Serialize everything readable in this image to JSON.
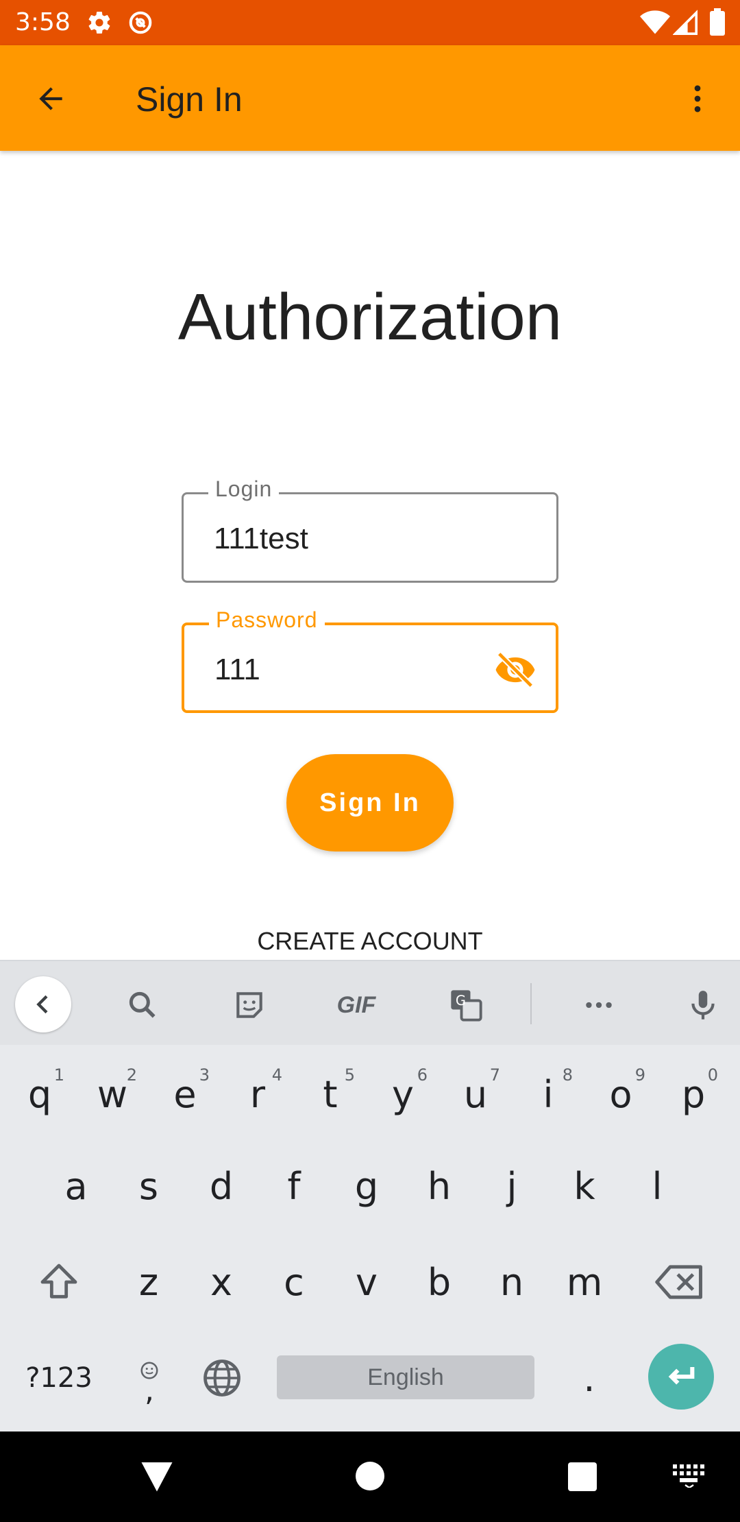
{
  "status_bar": {
    "time": "3:58",
    "icons": [
      "gear-icon",
      "sync-icon",
      "wifi-icon",
      "signal-icon",
      "battery-icon"
    ],
    "background": "#e65100"
  },
  "app_bar": {
    "title": "Sign In",
    "back_icon": "arrow-left-icon",
    "menu_icon": "more-vert-icon",
    "background": "#ff9800"
  },
  "main": {
    "heading": "Authorization",
    "login": {
      "label": "Login",
      "value": "111test"
    },
    "password": {
      "label": "Password",
      "value": "111",
      "toggle_icon": "eye-off-icon"
    },
    "sign_in_button": "Sign In",
    "create_account": "CREATE ACCOUNT",
    "accent": "#ff9800"
  },
  "keyboard": {
    "toolbar_icons": [
      "chevron-left-icon",
      "search-icon",
      "sticker-icon",
      "gif-icon",
      "translate-icon",
      "more-horiz-icon",
      "mic-icon"
    ],
    "gif_label": "GIF",
    "row1": [
      {
        "k": "q",
        "h": "1"
      },
      {
        "k": "w",
        "h": "2"
      },
      {
        "k": "e",
        "h": "3"
      },
      {
        "k": "r",
        "h": "4"
      },
      {
        "k": "t",
        "h": "5"
      },
      {
        "k": "y",
        "h": "6"
      },
      {
        "k": "u",
        "h": "7"
      },
      {
        "k": "i",
        "h": "8"
      },
      {
        "k": "o",
        "h": "9"
      },
      {
        "k": "p",
        "h": "0"
      }
    ],
    "row2": [
      "a",
      "s",
      "d",
      "f",
      "g",
      "h",
      "j",
      "k",
      "l"
    ],
    "row3": [
      "z",
      "x",
      "c",
      "v",
      "b",
      "n",
      "m"
    ],
    "symbols": "?123",
    "comma": ",",
    "space": "English",
    "period": ".",
    "enter_color": "#4db6ac"
  },
  "nav_bar": {
    "icons": [
      "back-triangle-icon",
      "home-circle-icon",
      "recents-square-icon",
      "keyboard-icon"
    ]
  }
}
